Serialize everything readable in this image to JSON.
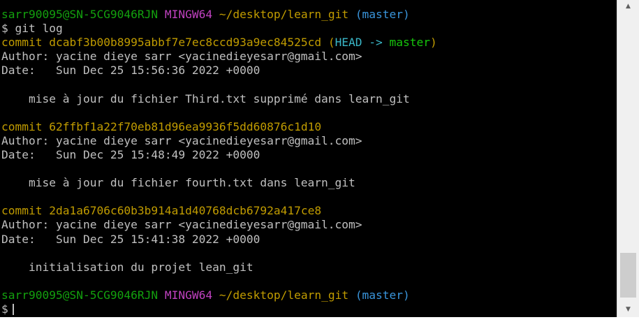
{
  "terminal": {
    "prompt1": {
      "user": "sarr90095@SN-5CG9046RJN",
      "env": "MINGW64",
      "path": "~/desktop/learn_git",
      "branch": "(master)"
    },
    "command": "$ git log",
    "commits": [
      {
        "label": "commit",
        "hash": "dcabf3b00b8995abbf7e7ec8ccd93a9ec84525cd",
        "refs_open": "(",
        "refs_head": "HEAD ->",
        "refs_branch": "master",
        "refs_close": ")",
        "author": "Author: yacine dieye sarr <yacinedieyesarr@gmail.com>",
        "date": "Date:   Sun Dec 25 15:56:36 2022 +0000",
        "message": "    mise à jour du fichier Third.txt supprimé dans learn_git"
      },
      {
        "label": "commit",
        "hash": "62ffbf1a22f70eb81d96ea9936f5dd60876c1d10",
        "author": "Author: yacine dieye sarr <yacinedieyesarr@gmail.com>",
        "date": "Date:   Sun Dec 25 15:48:49 2022 +0000",
        "message": "    mise à jour du fichier fourth.txt dans learn_git"
      },
      {
        "label": "commit",
        "hash": "2da1a6706c60b3b914a1d40768dcb6792a417ce8",
        "author": "Author: yacine dieye sarr <yacinedieyesarr@gmail.com>",
        "date": "Date:   Sun Dec 25 15:41:38 2022 +0000",
        "message": "    initialisation du projet lean_git"
      }
    ],
    "prompt2": {
      "user": "sarr90095@SN-5CG9046RJN",
      "env": "MINGW64",
      "path": "~/desktop/learn_git",
      "branch": "(master)"
    },
    "input_prompt": "$",
    "scroll_up_glyph": "▲",
    "scroll_down_glyph": "▼"
  },
  "colors": {
    "background": "#000000",
    "text": "#c0c0c0",
    "user": "#13a10e",
    "env": "#c142c1",
    "path_commit": "#c19c00",
    "branch": "#3a96dd"
  }
}
